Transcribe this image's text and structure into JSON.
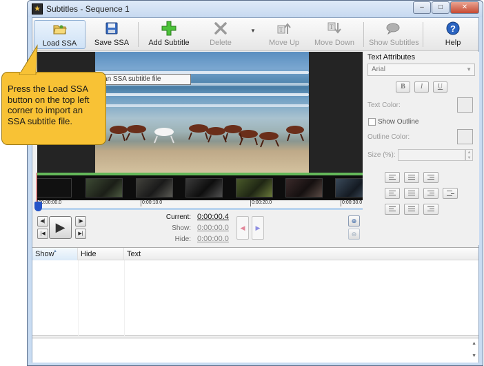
{
  "window": {
    "title": "Subtitles - Sequence 1",
    "controls": {
      "minimize": "–",
      "maximize": "□",
      "close": "✕"
    }
  },
  "toolbar": {
    "load_ssa": "Load SSA",
    "save_ssa": "Save SSA",
    "add_subtitle": "Add Subtitle",
    "delete": "Delete",
    "move_up": "Move Up",
    "move_down": "Move Down",
    "show_subtitles": "Show Subtitles",
    "help": "Help"
  },
  "tooltip": "Load an SSA subtitle file",
  "callout": "Press the Load SSA button on the top left corner to import an SSA subtitle file.",
  "timeline": {
    "ticks": [
      "00:00:00.0",
      "0:00:10.0",
      "0:00:20.0",
      "0:00:30.0"
    ],
    "current_label": "Current:",
    "current_value": "0:00:00.4",
    "show_label": "Show:",
    "show_value": "0:00:00.0",
    "hide_label": "Hide:",
    "hide_value": "0:00:00.0"
  },
  "attributes": {
    "title": "Text Attributes",
    "font": "Arial",
    "bold": "B",
    "italic": "I",
    "underline": "U",
    "text_color_label": "Text Color:",
    "show_outline_label": "Show Outline",
    "outline_color_label": "Outline Color:",
    "size_label": "Size (%):"
  },
  "grid": {
    "columns": [
      "Show",
      "Hide",
      "Text"
    ]
  },
  "colors": {
    "callout": "#f8c235",
    "timeline_green": "#64b85a",
    "playhead": "#2454c8"
  }
}
